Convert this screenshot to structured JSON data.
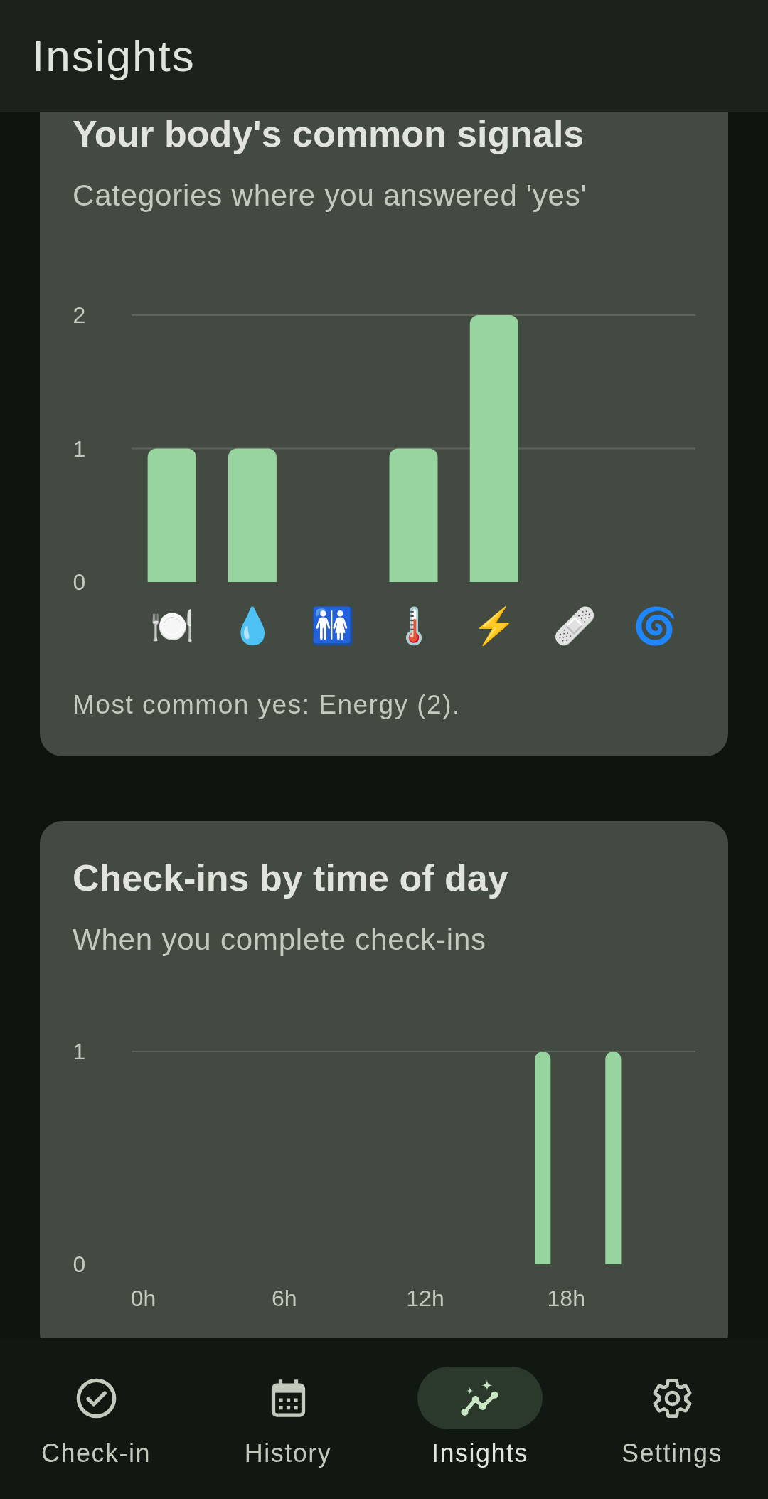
{
  "app_bar": {
    "title": "Insights"
  },
  "cards": [
    {
      "title": "Your body's common signals",
      "subtitle": "Categories where you answered 'yes'",
      "chart_data": {
        "type": "bar",
        "categories": [
          "🍽️",
          "💧",
          "🚻",
          "🌡️",
          "⚡️",
          "🩹",
          "🌀"
        ],
        "values": [
          1,
          1,
          0,
          1,
          2,
          0,
          0
        ],
        "ylim": [
          0,
          2
        ],
        "yticks": [
          0,
          1,
          2
        ]
      },
      "summary": "Most common yes: Energy (2)."
    },
    {
      "title": "Check-ins by time of day",
      "subtitle": "When you complete check-ins",
      "chart_data": {
        "type": "bar",
        "x": [
          17,
          20
        ],
        "values": [
          1,
          1
        ],
        "xlim": [
          -0.5,
          23.5
        ],
        "ylim": [
          0,
          1
        ],
        "xticks": [
          {
            "value": 0,
            "label": "0h"
          },
          {
            "value": 6,
            "label": "6h"
          },
          {
            "value": 12,
            "label": "12h"
          },
          {
            "value": 18,
            "label": "18h"
          }
        ],
        "yticks": [
          0,
          1
        ]
      }
    }
  ],
  "nav": {
    "items": [
      {
        "label": "Check-in",
        "selected": false
      },
      {
        "label": "History",
        "selected": false
      },
      {
        "label": "Insights",
        "selected": true
      },
      {
        "label": "Settings",
        "selected": false
      }
    ]
  }
}
